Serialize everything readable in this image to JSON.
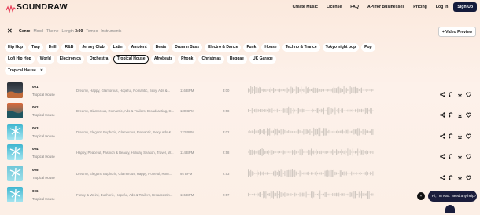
{
  "brand": {
    "name": "SOUNDRAW"
  },
  "nav": {
    "links": [
      "Create Music",
      "License",
      "FAQ",
      "API for Businesses",
      "Pricing",
      "Log In"
    ],
    "signup": "Sign Up"
  },
  "filters": {
    "tabs": [
      {
        "label": "Genre",
        "active": true
      },
      {
        "label": "Mood",
        "active": false
      },
      {
        "label": "Theme",
        "active": false
      },
      {
        "label": "Length",
        "value": "3:00",
        "active": false
      },
      {
        "label": "Tempo",
        "active": false
      },
      {
        "label": "Instruments",
        "active": false
      }
    ],
    "video_preview": "Video Preview"
  },
  "genres": {
    "row1": [
      "Hip Hop",
      "Trap",
      "Drill",
      "R&B",
      "Jersey Club",
      "Latin",
      "Ambient",
      "Beats",
      "Drum n Bass",
      "Electro & Dance",
      "Funk",
      "House",
      "Techno & Trance",
      "Tokyo night pop",
      "Pop"
    ],
    "row2": [
      "Lofi Hip Hop",
      "World",
      "Electronica",
      "Orchestra",
      "Tropical House",
      "Afrobeats",
      "Phonk",
      "Christmas",
      "Reggae",
      "UK Garage"
    ],
    "selected": "Tropical House"
  },
  "active_filter": {
    "label": "Tropical House"
  },
  "tracks": [
    {
      "num": "001",
      "genre": "Tropical House",
      "mood": "Dreamy, Happy, Glamorous, Hopeful, Romantic, Sexy, Ads &...",
      "bpm": "116 BPM",
      "duration": "3:00",
      "thumb": "dark"
    },
    {
      "num": "002",
      "genre": "Tropical House",
      "mood": "Dreamy, Glamorous, Romantic, Ads & Trailers, Broadcasting, C...",
      "bpm": "130 BPM",
      "duration": "2:58",
      "thumb": "sunset"
    },
    {
      "num": "003",
      "genre": "Tropical House",
      "mood": "Dreamy, Elegant, Euphoric, Glamorous, Romantic, Sexy, Ads &...",
      "bpm": "122 BPM",
      "duration": "3:02",
      "thumb": "palm"
    },
    {
      "num": "004",
      "genre": "Tropical House",
      "mood": "Happy, Peaceful, Fashion & Beauty, Holiday Season, Travel, W...",
      "bpm": "114 BPM",
      "duration": "2:58",
      "thumb": "palm"
    },
    {
      "num": "005",
      "genre": "Tropical House",
      "mood": "Dreamy, Elegant, Euphoric, Glamorous, Happy, Hopeful, Rom...",
      "bpm": "94 BPM",
      "duration": "2:53",
      "thumb": "tealpalm"
    },
    {
      "num": "006",
      "genre": "Tropical House",
      "mood": "Funny & Weird, Euphoric, Hopeful, Ads & Trailers, Broadcastin...",
      "bpm": "115 BPM",
      "duration": "2:57",
      "thumb": "palm"
    }
  ],
  "chat": {
    "message": "Hi, I'm Nao. Need any help?",
    "close": "×"
  },
  "colors": {
    "accent": "#141a3a",
    "background": "#fbe9dd",
    "wave": "#cfc7c0"
  }
}
